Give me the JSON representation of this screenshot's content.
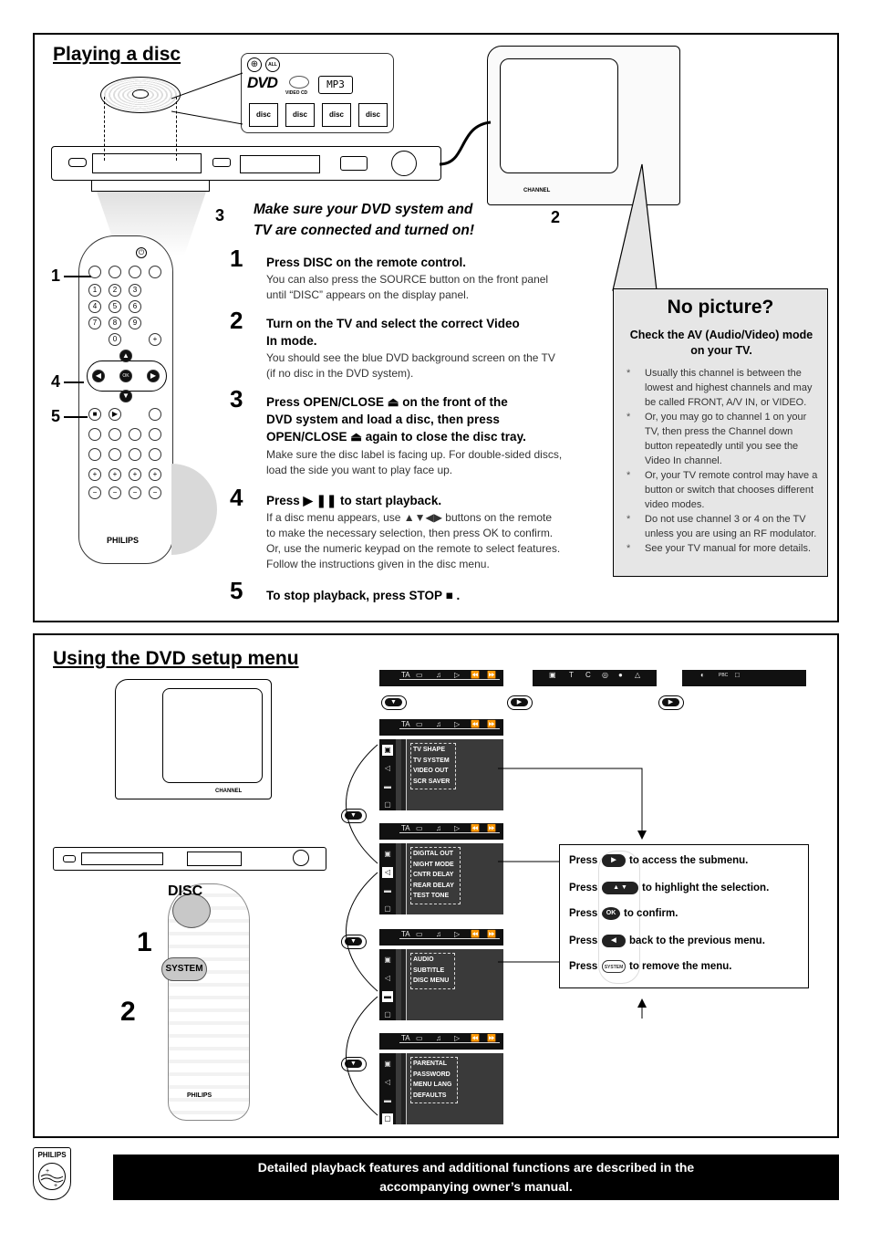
{
  "section1": {
    "title": "Playing a disc",
    "disc_logos": [
      "DVD VIDEO",
      "VIDEO CD",
      "MP3",
      "COMPACT DISC DIGITAL VIDEO",
      "COMPACT DISC DIGITAL AUDIO",
      "COMPACT DISC Recordable",
      "COMPACT DISC ReWritable"
    ],
    "region_badges": [
      "globe",
      "ALL"
    ],
    "connect_note_line1": "Make sure your DVD system and",
    "connect_note_line2": "TV are connected and turned on!",
    "callouts": [
      "1",
      "2",
      "3",
      "4",
      "5"
    ],
    "remote_brand": "PHILIPS",
    "tv_channel_label": "CHANNEL",
    "steps": [
      {
        "num": "1",
        "title": "Press DISC on the remote control.",
        "body": [
          "You can also press the SOURCE button on the front panel",
          "until “DISC” appears on the display panel."
        ]
      },
      {
        "num": "2",
        "title_lines": [
          "Turn on the TV and select the correct Video",
          "In mode."
        ],
        "body": [
          "You should see the blue DVD background screen on the TV",
          "(if no disc in the DVD system)."
        ]
      },
      {
        "num": "3",
        "title_lines": [
          "Press OPEN/CLOSE ⏏ on the front of the",
          "DVD system and load a disc, then press",
          "OPEN/CLOSE ⏏ again to close the disc tray."
        ],
        "body": [
          "Make sure the disc label is facing up.  For double-sided discs,",
          "load the side you want to play face up."
        ]
      },
      {
        "num": "4",
        "title": "Press ▶ ❚❚  to start playback.",
        "body": [
          "If a disc menu appears, use ▲▼◀▶ buttons on the remote",
          "to make the necessary selection, then press OK to confirm.",
          "Or, use the numeric keypad on the remote to select features.",
          "Follow the instructions given in the disc menu."
        ]
      },
      {
        "num": "5",
        "title": "To stop playback, press STOP ■ ."
      }
    ],
    "no_picture": {
      "title": "No picture?",
      "subtitle": "Check the AV (Audio/Video) mode on your TV.",
      "bullet_symbol": "*",
      "bullets": [
        "Usually this channel is between the lowest and highest channels and may be called FRONT, A/V IN, or VIDEO.",
        "Or, you may go to channel 1 on your TV, then press the Channel down button repeatedly until you see the Video In channel.",
        "Or, your TV remote control may have a button or switch that chooses different video modes.",
        "Do not use channel 3 or 4 on the TV unless you are using an RF modulator.",
        "See your TV manual for more details."
      ]
    }
  },
  "section2": {
    "title": "Using the DVD setup menu",
    "remote_labels": {
      "disc": "DISC",
      "system": "SYSTEM",
      "brand": "PHILIPS"
    },
    "callouts": [
      "1",
      "2"
    ],
    "tv_channel_label": "CHANNEL",
    "nav_buttons": {
      "down": "▼",
      "right": "▶"
    },
    "top_bar_icons": [
      "TA",
      "▭",
      "♫",
      "▷",
      "⏪",
      "⏩"
    ],
    "sub_bar2_icons": [
      "▣",
      "T",
      "C",
      "◎",
      "●",
      "△"
    ],
    "sub_bar3_icons": [
      "◐",
      "PBC",
      "□"
    ],
    "menus": [
      {
        "name": "video",
        "items": [
          "TV SHAPE",
          "TV SYSTEM",
          "VIDEO OUT",
          "SCR SAVER"
        ],
        "active_icon": 0
      },
      {
        "name": "audio",
        "items": [
          "DIGITAL OUT",
          "NIGHT MODE",
          "CNTR DELAY",
          "REAR DELAY",
          "TEST TONE"
        ],
        "active_icon": 1
      },
      {
        "name": "language",
        "items": [
          "AUDIO",
          "SUBTITLE",
          "DISC MENU"
        ],
        "active_icon": 2
      },
      {
        "name": "preference",
        "items": [
          "PARENTAL",
          "PASSWORD",
          "MENU LANG",
          "DEFAULTS"
        ],
        "active_icon": 3
      }
    ],
    "side_icons": [
      "▣",
      "◁",
      "▬",
      "▢"
    ],
    "instructions": {
      "press_word": "Press",
      "rows": [
        {
          "button": "▶",
          "text": "to access the submenu."
        },
        {
          "button": "▲ ▼",
          "text": "to highlight the selection."
        },
        {
          "button": "OK",
          "text": "to confirm."
        },
        {
          "button": "◀",
          "text": "back to the previous menu."
        },
        {
          "button": "SYSTEM",
          "text": "to remove the menu."
        }
      ]
    }
  },
  "footer": {
    "logo_text": "PHILIPS",
    "note_line1": "Detailed playback features and additional functions are described in the",
    "note_line2": "accompanying owner’s manual."
  }
}
